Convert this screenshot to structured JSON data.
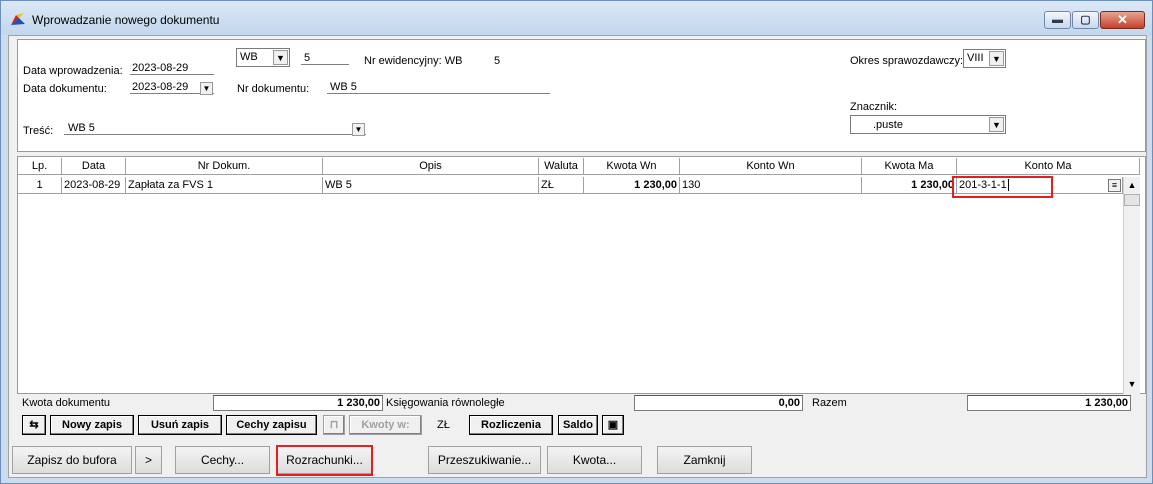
{
  "window": {
    "title": "Wprowadzanie nowego dokumentu",
    "min_glyph": "▬",
    "max_glyph": "▢",
    "close_glyph": "✕"
  },
  "header": {
    "data_wprowadzenia_label": "Data wprowadzenia:",
    "data_wprowadzenia_value": "2023-08-29",
    "data_dokumentu_label": "Data dokumentu:",
    "data_dokumentu_value": "2023-08-29",
    "typ_value": "WB",
    "numer_value": "5",
    "nr_ewidencyjny_label": "Nr ewidencyjny: WB",
    "nr_ewidencyjny_value": "5",
    "nr_dokumentu_label": "Nr dokumentu:",
    "nr_dokumentu_value": "WB 5",
    "tresc_label": "Treść:",
    "tresc_value": "WB 5",
    "okres_label": "Okres sprawozdawczy:",
    "okres_value": "VIII",
    "znacznik_label": "Znacznik:",
    "znacznik_value": ".puste"
  },
  "grid": {
    "columns": [
      "Lp.",
      "Data",
      "Nr Dokum.",
      "Opis",
      "Waluta",
      "Kwota Wn",
      "Konto Wn",
      "Kwota Ma",
      "Konto Ma"
    ],
    "rows": [
      {
        "lp": "1",
        "data": "2023-08-29",
        "nr_dokum": "Zapłata za FVS 1",
        "opis": "WB 5",
        "waluta": "ZŁ",
        "kwota_wn": "1 230,00",
        "konto_wn": "130",
        "kwota_ma": "1 230,00",
        "konto_ma": "201-3-1-1"
      }
    ]
  },
  "summary": {
    "kwota_dokumentu_label": "Kwota dokumentu",
    "kwota_dokumentu_value": "1 230,00",
    "ksiegowania_label": "Księgowania równoległe",
    "ksiegowania_value": "0,00",
    "razem_label": "Razem",
    "razem_value": "1 230,00"
  },
  "toolbar": {
    "nowy_zapis": "Nowy zapis",
    "usun_zapis": "Usuń zapis",
    "cechy_zapisu": "Cechy zapisu",
    "kwoty_w": "Kwoty w:",
    "waluta": "ZŁ",
    "rozliczenia": "Rozliczenia",
    "saldo": "Saldo"
  },
  "buttons": {
    "zapisz_do_bufora": "Zapisz do bufora",
    "more": ">",
    "cechy": "Cechy...",
    "rozrachunki": "Rozrachunki...",
    "przeszukiwanie": "Przeszukiwanie...",
    "kwota": "Kwota...",
    "zamknij": "Zamknij"
  }
}
